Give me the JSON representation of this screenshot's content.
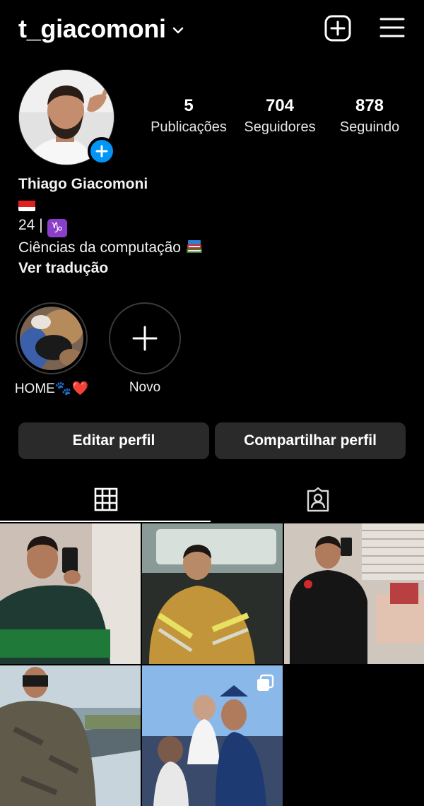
{
  "header": {
    "username": "t_giacomoni",
    "chevron_icon": "chevron-down-icon",
    "create_icon": "plus-square-icon",
    "menu_icon": "hamburger-menu-icon"
  },
  "profile": {
    "add_story_icon": "plus-icon",
    "stats": [
      {
        "value": "5",
        "label": "Publicações"
      },
      {
        "value": "704",
        "label": "Seguidores"
      },
      {
        "value": "878",
        "label": "Seguindo"
      }
    ],
    "bio": {
      "name": "Thiago Giacomoni",
      "age_line": "24 |",
      "capricorn_symbol": "♑",
      "occupation": "Ciências da computação",
      "see_translation": "Ver tradução"
    }
  },
  "highlights": [
    {
      "label": "HOME🐾❤️"
    },
    {
      "label": "Novo"
    }
  ],
  "buttons": {
    "edit_profile": "Editar perfil",
    "share_profile": "Compartilhar perfil"
  },
  "tabs": [
    {
      "icon": "grid-icon",
      "active": true
    },
    {
      "icon": "tagged-icon",
      "active": false
    }
  ],
  "colors": {
    "background": "#000000",
    "button_bg": "#2a2a2a",
    "accent_blue": "#0095f6",
    "capricorn_purple": "#8b3ec9"
  }
}
